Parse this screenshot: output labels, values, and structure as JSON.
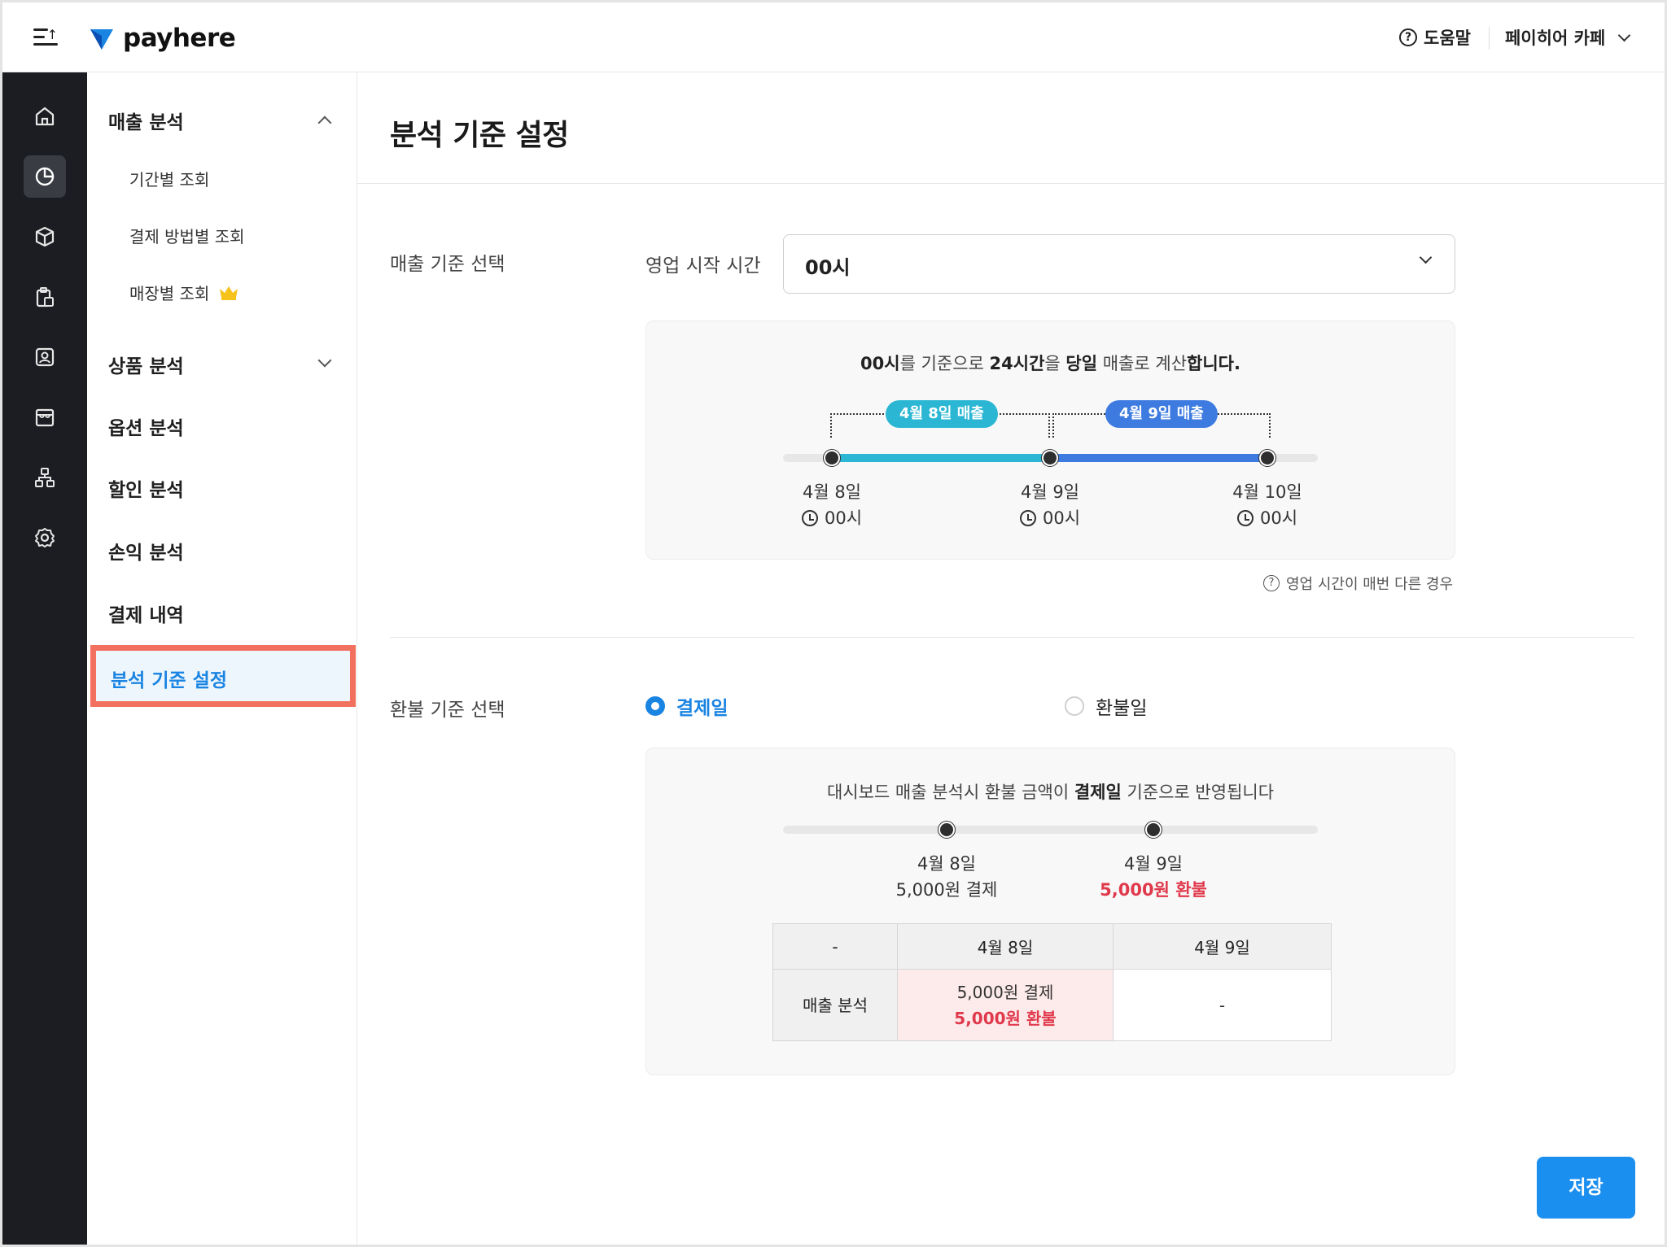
{
  "brand": {
    "name": "payhere",
    "accent": "#1a84e2"
  },
  "topbar": {
    "help_label": "도움말",
    "store_name": "페이히어 카페"
  },
  "rail": {
    "items": [
      "home-icon",
      "chart-icon",
      "box-icon",
      "clipboard-icon",
      "contact-icon",
      "store-icon",
      "org-icon",
      "gear-icon"
    ],
    "active": "chart-icon"
  },
  "subnav": {
    "sales_analysis": "매출 분석",
    "sales_children": [
      "기간별 조회",
      "결제 방법별 조회",
      "매장별 조회"
    ],
    "product_analysis": "상품 분석",
    "option_analysis": "옵션 분석",
    "discount_analysis": "할인 분석",
    "profit_analysis": "손익 분석",
    "payment_history": "결제 내역",
    "criteria_settings": "분석 기준 설정"
  },
  "page": {
    "title": "분석 기준 설정"
  },
  "sales_basis": {
    "section_label": "매출 기준 선택",
    "field_label": "영업 시작 시간",
    "selected_value": "00시",
    "caption": {
      "p1": "00시",
      "p2": "를 기준으로 ",
      "p3": "24시간",
      "p4": "을 ",
      "p5": "당일",
      "p6": " 매출로 계산",
      "p7": "합니다."
    },
    "periods": [
      "4월 8일 매출",
      "4월 9일 매출"
    ],
    "points": [
      {
        "date": "4월 8일",
        "time": "00시"
      },
      {
        "date": "4월 9일",
        "time": "00시"
      },
      {
        "date": "4월 10일",
        "time": "00시"
      }
    ],
    "hint": "영업 시간이 매번 다른 경우"
  },
  "refund_basis": {
    "section_label": "환불 기준 선택",
    "options": [
      {
        "label": "결제일",
        "selected": true
      },
      {
        "label": "환불일",
        "selected": false
      }
    ],
    "caption": {
      "p1": "대시보드 매출 분석시 환불 금액이 ",
      "p2": "결제일",
      "p3": " 기준으로 반영됩니다"
    },
    "points": [
      {
        "date": "4월 8일",
        "event": "5,000원 결제"
      },
      {
        "date": "4월 9일",
        "event": "5,000원 환불"
      }
    ],
    "table": {
      "headers": [
        "-",
        "4월 8일",
        "4월 9일"
      ],
      "row_label": "매출 분석",
      "cell_day1_line1": "5,000원 결제",
      "cell_day1_line2": "5,000원 환불",
      "cell_day2": "-"
    }
  },
  "actions": {
    "save_label": "저장"
  },
  "colors": {
    "period1": "#2bb7d4",
    "period2": "#3d7be0",
    "refund_red": "#e0394c",
    "highlight_border": "#f2705e"
  }
}
